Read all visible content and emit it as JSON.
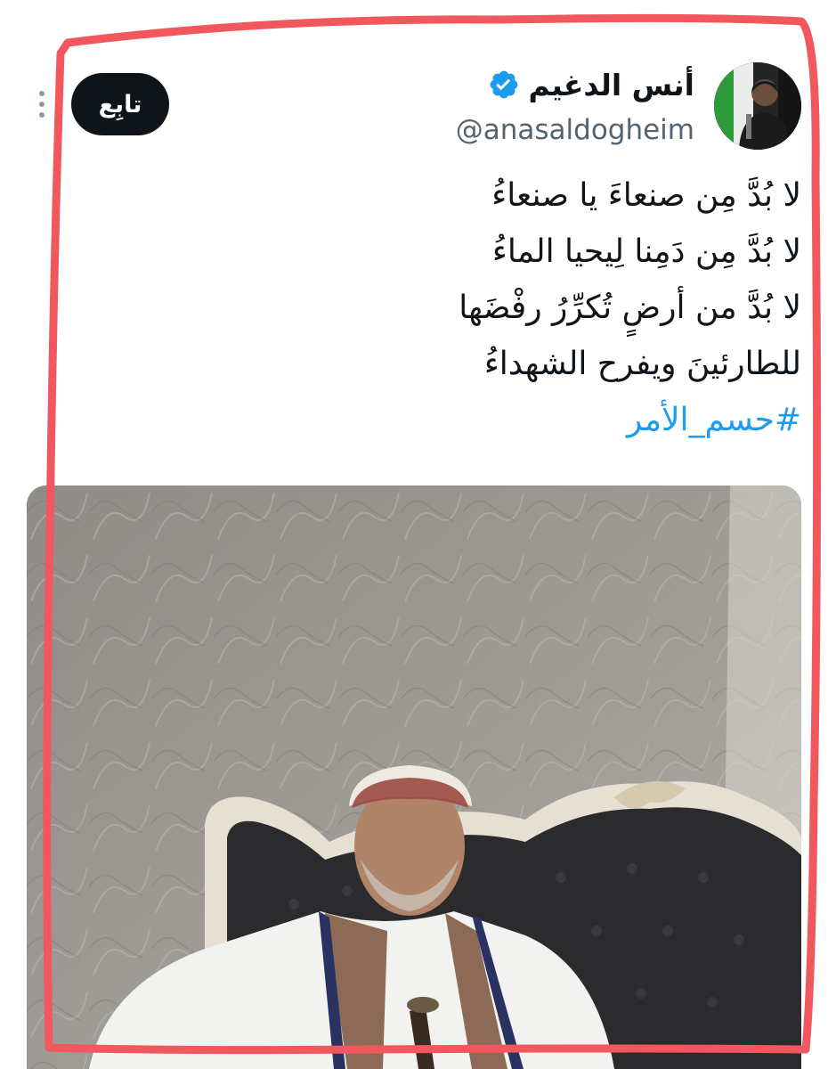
{
  "tweet": {
    "author": {
      "display_name": "أنس الدغيم",
      "handle": "@anasaldogheim",
      "verified": true,
      "avatar_icon": "profile-photo-icon"
    },
    "follow_label": "تابِع",
    "text_lines": [
      "لا بُدَّ مِن صنعاءَ يا صنعاءُ",
      "لا بُدَّ مِن دَمِنا لِيحيا الماءُ",
      "لا بُدَّ من أرضٍ تُكرِّرُ رفْضَها",
      "للطارئينَ ويفرح الشهداءُ"
    ],
    "hashtag": "#حسم_الأمر",
    "media": {
      "icon": "photo-of-man-on-sofa"
    }
  },
  "colors": {
    "text": "#0f1419",
    "secondary": "#536471",
    "link": "#1d9bf0",
    "verified": "#1d9bf0",
    "follow_bg": "#0f1419",
    "annotation_frame": "#f0585e"
  }
}
